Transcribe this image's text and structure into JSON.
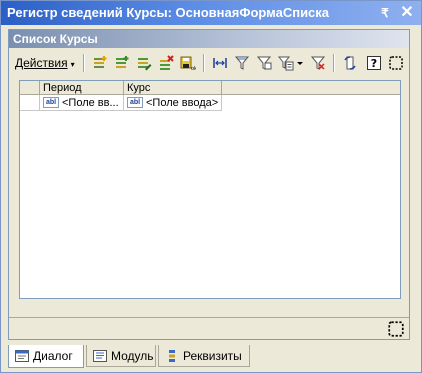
{
  "window": {
    "title": "Регистр сведений Курсы: ОсновнаяФормаСписка",
    "pin_glyph": "₹",
    "close_glyph": "✕"
  },
  "form": {
    "header": "Список Курсы"
  },
  "toolbar": {
    "actions_label": "Действия",
    "actions_arrow": "▾",
    "icons": [
      "add-row-icon",
      "add-copy-icon",
      "edit-row-icon",
      "delete-row-icon",
      "save-close-icon",
      "range-icon",
      "filter-value-icon",
      "filter-icon",
      "filter-list-icon",
      "filter-off-icon",
      "refresh-icon",
      "help-icon",
      "frame-icon"
    ]
  },
  "table": {
    "columns": [
      "Период",
      "Курс"
    ],
    "rows": [
      {
        "cells": [
          "<Поле вв...",
          "<Поле ввода>"
        ]
      }
    ],
    "field_icon": "abl"
  },
  "tabs": [
    {
      "label": "Диалог",
      "icon": "dialog-icon",
      "active": true
    },
    {
      "label": "Модуль",
      "icon": "module-icon",
      "active": false
    },
    {
      "label": "Реквизиты",
      "icon": "attributes-icon",
      "active": false
    }
  ],
  "colors": {
    "title_bar": "#2c5fc6",
    "form_header": "#7a8fb0",
    "panel": "#ece9d8"
  }
}
